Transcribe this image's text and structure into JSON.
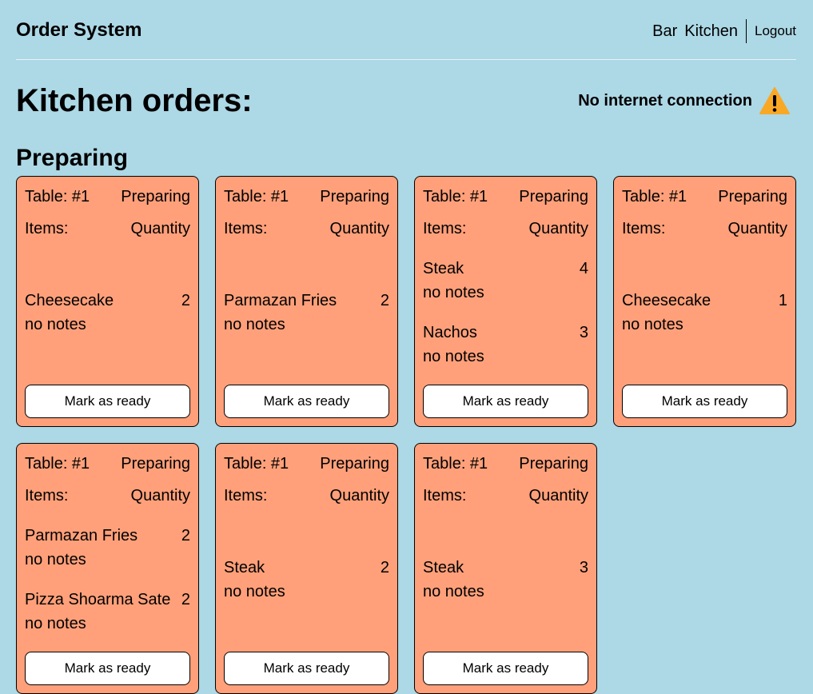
{
  "header": {
    "title": "Order System",
    "nav": {
      "bar": "Bar",
      "kitchen": "Kitchen",
      "logout": "Logout"
    }
  },
  "page": {
    "title": "Kitchen orders:",
    "offline_message": "No internet connection",
    "section_title": "Preparing"
  },
  "colors": {
    "background": "#add8e6",
    "card": "#ffa07a",
    "warning": "#f9a825"
  },
  "icons": {
    "warning": "warning-icon"
  },
  "orders": [
    {
      "table": "Table: #1",
      "status": "Preparing",
      "items_label": "Items:",
      "quantity_label": "Quantity",
      "items": [
        {
          "name": "Cheesecake",
          "qty": "2",
          "notes": "no notes"
        }
      ],
      "button": "Mark as ready"
    },
    {
      "table": "Table: #1",
      "status": "Preparing",
      "items_label": "Items:",
      "quantity_label": "Quantity",
      "items": [
        {
          "name": "Parmazan Fries",
          "qty": "2",
          "notes": "no notes"
        }
      ],
      "button": "Mark as ready"
    },
    {
      "table": "Table: #1",
      "status": "Preparing",
      "items_label": "Items:",
      "quantity_label": "Quantity",
      "items": [
        {
          "name": "Steak",
          "qty": "4",
          "notes": "no notes"
        },
        {
          "name": "Nachos",
          "qty": "3",
          "notes": "no notes"
        }
      ],
      "button": "Mark as ready"
    },
    {
      "table": "Table: #1",
      "status": "Preparing",
      "items_label": "Items:",
      "quantity_label": "Quantity",
      "items": [
        {
          "name": "Cheesecake",
          "qty": "1",
          "notes": "no notes"
        }
      ],
      "button": "Mark as ready"
    },
    {
      "table": "Table: #1",
      "status": "Preparing",
      "items_label": "Items:",
      "quantity_label": "Quantity",
      "items": [
        {
          "name": "Parmazan Fries",
          "qty": "2",
          "notes": "no notes"
        },
        {
          "name": "Pizza Shoarma Sate",
          "qty": "2",
          "notes": "no notes"
        }
      ],
      "button": "Mark as ready"
    },
    {
      "table": "Table: #1",
      "status": "Preparing",
      "items_label": "Items:",
      "quantity_label": "Quantity",
      "items": [
        {
          "name": "Steak",
          "qty": "2",
          "notes": "no notes"
        }
      ],
      "button": "Mark as ready"
    },
    {
      "table": "Table: #1",
      "status": "Preparing",
      "items_label": "Items:",
      "quantity_label": "Quantity",
      "items": [
        {
          "name": "Steak",
          "qty": "3",
          "notes": "no notes"
        }
      ],
      "button": "Mark as ready"
    }
  ]
}
